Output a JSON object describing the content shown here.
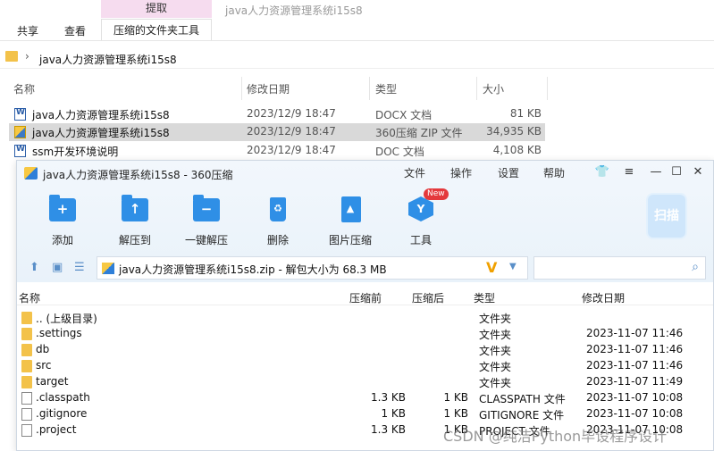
{
  "explorer": {
    "context_tab": "提取",
    "window_title": "java人力资源管理系统i15s8",
    "ribbon_tabs": [
      "共享",
      "查看",
      "压缩的文件夹工具"
    ],
    "address": "java人力资源管理系统i15s8",
    "columns": {
      "name": "名称",
      "date": "修改日期",
      "type": "类型",
      "size": "大小"
    },
    "rows": [
      {
        "name": "java人力资源管理系统i15s8",
        "date": "2023/12/9 18:47",
        "type": "DOCX 文档",
        "size": "81 KB",
        "icon": "word-doc-icon"
      },
      {
        "name": "java人力资源管理系统i15s8",
        "date": "2023/12/9 18:47",
        "type": "360压缩 ZIP 文件",
        "size": "34,935 KB",
        "icon": "zip-icon"
      },
      {
        "name": "ssm开发环境说明",
        "date": "2023/12/9 18:47",
        "type": "DOC 文档",
        "size": "4,108 KB",
        "icon": "word-doc-icon"
      }
    ]
  },
  "zip": {
    "title": "java人力资源管理系统i15s8 - 360压缩",
    "menu": [
      "文件",
      "操作",
      "设置",
      "帮助"
    ],
    "toolbar": {
      "add": "添加",
      "extract_to": "解压到",
      "one_click": "一键解压",
      "delete": "删除",
      "image_compress": "图片压缩",
      "tools": "工具",
      "new_badge": "New",
      "scan": "扫描"
    },
    "path": "java人力资源管理系统i15s8.zip - 解包大小为 68.3 MB",
    "columns": {
      "name": "名称",
      "size": "压缩前",
      "csize": "压缩后",
      "type": "类型",
      "date": "修改日期"
    },
    "rows": [
      {
        "name": ".. (上级目录)",
        "size": "",
        "csize": "",
        "type": "文件夹",
        "date": "",
        "kind": "folder"
      },
      {
        "name": ".settings",
        "size": "",
        "csize": "",
        "type": "文件夹",
        "date": "2023-11-07 11:46",
        "kind": "folder"
      },
      {
        "name": "db",
        "size": "",
        "csize": "",
        "type": "文件夹",
        "date": "2023-11-07 11:46",
        "kind": "folder"
      },
      {
        "name": "src",
        "size": "",
        "csize": "",
        "type": "文件夹",
        "date": "2023-11-07 11:46",
        "kind": "folder"
      },
      {
        "name": "target",
        "size": "",
        "csize": "",
        "type": "文件夹",
        "date": "2023-11-07 11:49",
        "kind": "folder"
      },
      {
        "name": ".classpath",
        "size": "1.3 KB",
        "csize": "1 KB",
        "type": "CLASSPATH 文件",
        "date": "2023-11-07 10:08",
        "kind": "file"
      },
      {
        "name": ".gitignore",
        "size": "1 KB",
        "csize": "1 KB",
        "type": "GITIGNORE 文件",
        "date": "2023-11-07 10:08",
        "kind": "file"
      },
      {
        "name": ".project",
        "size": "1.3 KB",
        "csize": "1 KB",
        "type": "PROJECT 文件",
        "date": "2023-11-07 10:08",
        "kind": "file"
      }
    ]
  },
  "watermark": "CSDN @纯洁Python毕设程序设计"
}
